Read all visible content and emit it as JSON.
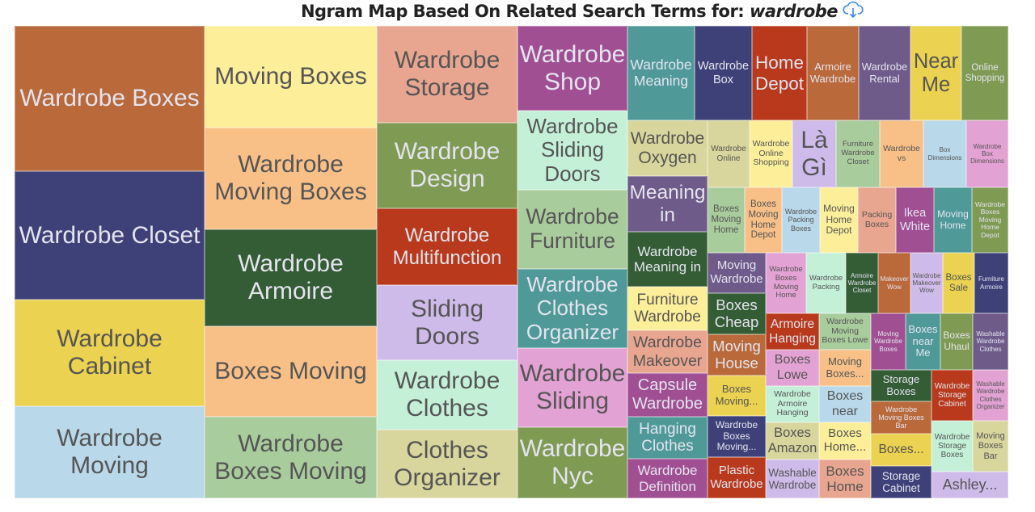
{
  "title": {
    "prefix": "Ngram Map Based On Related Search Terms for:",
    "term": "wardrobe",
    "download_icon": "cloud-download-icon",
    "icon_color": "#3b82f6"
  },
  "chart_data": {
    "type": "treemap",
    "title": "Ngram Map Based On Related Search Terms for: wardrobe",
    "dark_text_color": "#555555",
    "light_text_color": "#e4e4ee",
    "cells": [
      {
        "label": "Wardrobe Boxes",
        "color": "#b9693a"
      },
      {
        "label": "Wardrobe Closet",
        "color": "#3e4178"
      },
      {
        "label": "Wardrobe Cabinet",
        "color": "#ebd250"
      },
      {
        "label": "Wardrobe Moving",
        "color": "#b9d8e9"
      },
      {
        "label": "Moving Boxes",
        "color": "#fdee99"
      },
      {
        "label": "Wardrobe Moving Boxes",
        "color": "#f8c087"
      },
      {
        "label": "Wardrobe Armoire",
        "color": "#345c35"
      },
      {
        "label": "Boxes Moving",
        "color": "#f8c087"
      },
      {
        "label": "Wardrobe Boxes Moving",
        "color": "#a9cc9d"
      },
      {
        "label": "Wardrobe Storage",
        "color": "#e8a690"
      },
      {
        "label": "Wardrobe Design",
        "color": "#7f9a53"
      },
      {
        "label": "Wardrobe Multifunction",
        "color": "#b8391b"
      },
      {
        "label": "Sliding Doors",
        "color": "#cebbe9"
      },
      {
        "label": "Wardrobe Clothes",
        "color": "#c4f0d8"
      },
      {
        "label": "Clothes Organizer",
        "color": "#d8d69c"
      },
      {
        "label": "Wardrobe Shop",
        "color": "#a04f93"
      },
      {
        "label": "Wardrobe Sliding Doors",
        "color": "#c4f0d8"
      },
      {
        "label": "Wardrobe Furniture",
        "color": "#a9cc9d"
      },
      {
        "label": "Wardrobe Clothes Organizer",
        "color": "#4f9a98"
      },
      {
        "label": "Wardrobe Sliding",
        "color": "#e3a2d4"
      },
      {
        "label": "Wardrobe Nyc",
        "color": "#7f9a53"
      },
      {
        "label": "Wardrobe Meaning",
        "color": "#4f9a98"
      },
      {
        "label": "Wardrobe Box",
        "color": "#3e4178"
      },
      {
        "label": "Home Depot",
        "color": "#b8391b"
      },
      {
        "label": "Armoire Wardrobe",
        "color": "#b9693a"
      },
      {
        "label": "Wardrobe Rental",
        "color": "#6e5b8a"
      },
      {
        "label": "Near Me",
        "color": "#ebd250"
      },
      {
        "label": "Online Shopping",
        "color": "#7f9a53"
      },
      {
        "label": "Wardrobe Oxygen",
        "color": "#d8d69c"
      },
      {
        "label": "Meaning in",
        "color": "#6e5b8a"
      },
      {
        "label": "Wardrobe Meaning in",
        "color": "#345c35"
      },
      {
        "label": "Furniture Wardrobe",
        "color": "#fdee99"
      },
      {
        "label": "Wardrobe Makeover",
        "color": "#e8a690"
      },
      {
        "label": "Capsule Wardrobe",
        "color": "#a04f93"
      },
      {
        "label": "Hanging Clothes",
        "color": "#4f9a98"
      },
      {
        "label": "Wardrobe Definition",
        "color": "#a04f93"
      },
      {
        "label": "Wardrobe Online",
        "color": "#d8d69c"
      },
      {
        "label": "Wardrobe Online Shopping",
        "color": "#fdee99"
      },
      {
        "label": "Là Gì",
        "color": "#cebbe9"
      },
      {
        "label": "Furniture Wardrobe Closet",
        "color": "#a9cc9d"
      },
      {
        "label": "Wardrobe vs",
        "color": "#f8c087"
      },
      {
        "label": "Box Dimensions",
        "color": "#b9d8e9"
      },
      {
        "label": "Wardrobe Box Dimensions",
        "color": "#e3a2d4"
      },
      {
        "label": "Boxes Moving Home",
        "color": "#a9cc9d"
      },
      {
        "label": "Boxes Moving Home Depot",
        "color": "#f8c087"
      },
      {
        "label": "Wardrobe Packing Boxes",
        "color": "#b9d8e9"
      },
      {
        "label": "Moving Home Depot",
        "color": "#fdee99"
      },
      {
        "label": "Packing Boxes",
        "color": "#e8a690"
      },
      {
        "label": "Ikea White",
        "color": "#a04f93"
      },
      {
        "label": "Moving Home",
        "color": "#4f9a98"
      },
      {
        "label": "Wardrobe Boxes Moving Home Depot",
        "color": "#7f9a53"
      },
      {
        "label": "Moving Wardrobe",
        "color": "#6e5b8a"
      },
      {
        "label": "Boxes Cheap",
        "color": "#345c35"
      },
      {
        "label": "Moving House",
        "color": "#b9693a"
      },
      {
        "label": "Boxes Moving...",
        "color": "#ebd250"
      },
      {
        "label": "Wardrobe Boxes Moving...",
        "color": "#3e4178"
      },
      {
        "label": "Plastic Wardrobe",
        "color": "#b8391b"
      },
      {
        "label": "Wardrobe Boxes Moving Home",
        "color": "#e3a2d4"
      },
      {
        "label": "Wardrobe Packing",
        "color": "#c4f0d8"
      },
      {
        "label": "Armoire Wardrobe Closet",
        "color": "#345c35"
      },
      {
        "label": "Makeover Wow",
        "color": "#b9693a"
      },
      {
        "label": "Wardrobe Makeover Wow",
        "color": "#cebbe9"
      },
      {
        "label": "Boxes Sale",
        "color": "#ebd250"
      },
      {
        "label": "Furniture Armoire",
        "color": "#3e4178"
      },
      {
        "label": "Armoire Hanging",
        "color": "#b8391b"
      },
      {
        "label": "Wardrobe Moving Boxes Lowe",
        "color": "#a9cc9d"
      },
      {
        "label": "Moving Wardrobe Boxes",
        "color": "#a04f93"
      },
      {
        "label": "Boxes near Me",
        "color": "#4f9a98"
      },
      {
        "label": "Boxes Uhaul",
        "color": "#7f9a53"
      },
      {
        "label": "Washable Wardrobe Clothes",
        "color": "#6e5b8a"
      },
      {
        "label": "Boxes Lowe",
        "color": "#e3a2d4"
      },
      {
        "label": "Moving Boxes...",
        "color": "#f8c087"
      },
      {
        "label": "Wardrobe Armoire Hanging",
        "color": "#c4f0d8"
      },
      {
        "label": "Boxes near",
        "color": "#b9d8e9"
      },
      {
        "label": "Boxes Amazon",
        "color": "#d8d69c"
      },
      {
        "label": "Boxes Home...",
        "color": "#fdee99"
      },
      {
        "label": "Washable Wardrobe",
        "color": "#cebbe9"
      },
      {
        "label": "Boxes Home",
        "color": "#e8a690"
      },
      {
        "label": "Storage Boxes",
        "color": "#345c35"
      },
      {
        "label": "Wardrobe Moving Boxes Bar",
        "color": "#b9693a"
      },
      {
        "label": "Boxes...",
        "color": "#ebd250"
      },
      {
        "label": "Storage Cabinet",
        "color": "#3e4178"
      },
      {
        "label": "Wardrobe Storage Cabinet",
        "color": "#b8391b"
      },
      {
        "label": "Washable Wardrobe Clothes Organizer",
        "color": "#e3a2d4"
      },
      {
        "label": "Wardrobe Storage Boxes",
        "color": "#c4f0d8"
      },
      {
        "label": "Moving Boxes Bar",
        "color": "#d8d69c"
      },
      {
        "label": "Ashley...",
        "color": "#cebbe9"
      }
    ]
  }
}
